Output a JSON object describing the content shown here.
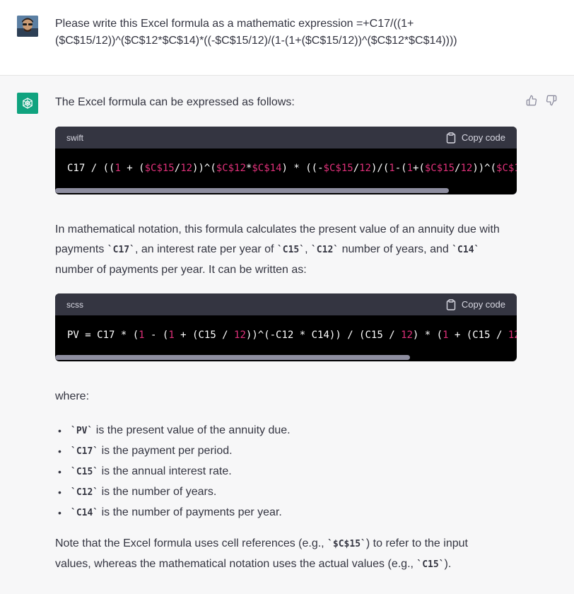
{
  "user": {
    "avatar_icon": "user-avatar-photo",
    "message_line1": "Please write this Excel formula as a mathematic expression =+C17/((1+",
    "message_line2": "($C$15/12))^($C$12*$C$14)*((-$C$15/12)/(1-(1+($C$15/12))^($C$12*$C$14))))"
  },
  "assistant": {
    "logo_icon": "openai-logo-icon",
    "feedback": {
      "like_icon": "thumbs-up-icon",
      "dislike_icon": "thumbs-down-icon"
    },
    "intro": "The Excel formula can be expressed as follows:",
    "code1": {
      "language": "swift",
      "copy_label": "Copy code",
      "code": "C17 / ((1 + ($C$15/12))^($C$12*$C$14) * ((-$C$15/12)/(1-(1+($C$15/12))^($C$1"
    },
    "para2": {
      "t1": "In mathematical notation, this formula calculates the present value of an annuity due with",
      "t2": "payments ",
      "c1": "`C17`",
      "t3": ", an interest rate per year of ",
      "c2": "`C15`",
      "t4": ", ",
      "c3": "`C12`",
      "t5": " number of years, and ",
      "c4": "`C14`",
      "t6": "number of payments per year. It can be written as:"
    },
    "code2": {
      "language": "scss",
      "copy_label": "Copy code",
      "code": "PV = C17 * (1 - (1 + (C15 / 12))^(-C12 * C14)) / (C15 / 12) * (1 + (C15 / 12"
    },
    "where": "where:",
    "bullets": [
      {
        "code": "`PV`",
        "text": " is the present value of the annuity due."
      },
      {
        "code": "`C17`",
        "text": " is the payment per period."
      },
      {
        "code": "`C15`",
        "text": " is the annual interest rate."
      },
      {
        "code": "`C12`",
        "text": " is the number of years."
      },
      {
        "code": "`C14`",
        "text": " is the number of payments per year."
      }
    ],
    "note": {
      "t1": "Note that the Excel formula uses cell references (e.g., ",
      "c1": "`$C$15`",
      "t2": ") to refer to the input",
      "t3": "values, whereas the mathematical notation uses the actual values (e.g., ",
      "c2": "`C15`",
      "t4": ")."
    }
  }
}
